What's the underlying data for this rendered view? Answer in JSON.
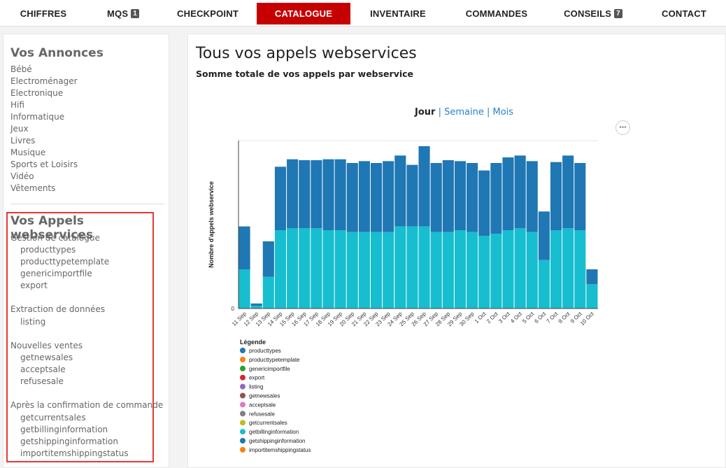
{
  "nav": {
    "items": [
      {
        "label": "CHIFFRES",
        "badge": ""
      },
      {
        "label": "MQS",
        "badge": "1"
      },
      {
        "label": "CHECKPOINT",
        "badge": ""
      },
      {
        "label": "CATALOGUE",
        "badge": ""
      },
      {
        "label": "INVENTAIRE",
        "badge": ""
      },
      {
        "label": "COMMANDES",
        "badge": ""
      },
      {
        "label": "CONSEILS",
        "badge": "7"
      },
      {
        "label": "CONTACT",
        "badge": ""
      }
    ],
    "active": "CATALOGUE",
    "active_color": "#c60000"
  },
  "sidebar": {
    "annonces_title": "Vos Annonces",
    "annonces": [
      "Bébé",
      "Electroménager",
      "Electronique",
      "Hifi",
      "Informatique",
      "Jeux",
      "Livres",
      "Musique",
      "Sports et Loisirs",
      "Vidéo",
      "Vêtements"
    ],
    "ws_title": "Vos Appels webservices",
    "groups": [
      {
        "title": "Gestion de catalogue",
        "items": [
          "producttypes",
          "producttypetemplate",
          "genericimportfile",
          "export"
        ]
      },
      {
        "title": "Extraction de données",
        "items": [
          "listing"
        ]
      },
      {
        "title": "Nouvelles ventes",
        "items": [
          "getnewsales",
          "acceptsale",
          "refusesale"
        ]
      },
      {
        "title": "Après la confirmation de commande",
        "items": [
          "getcurrentsales",
          "getbillinginformation",
          "getshippinginformation",
          "importitemshippingstatus"
        ]
      }
    ]
  },
  "main": {
    "title": "Tous vos appels webservices",
    "subtitle": "Somme totale de vos appels par webservice",
    "periods": {
      "selected": "Jour",
      "links": [
        "Semaine",
        "Mois"
      ],
      "separator": "|"
    },
    "menu_icon": "more-dots-icon"
  },
  "chart_data": {
    "type": "bar",
    "stacked": true,
    "categories": [
      "11 Sep",
      "12 Sep",
      "13 Sep",
      "14 Sep",
      "15 Sep",
      "16 Sep",
      "17 Sep",
      "18 Sep",
      "19 Sep",
      "20 Sep",
      "21 Sep",
      "22 Sep",
      "23 Sep",
      "24 Sep",
      "25 Sep",
      "26 Sep",
      "27 Sep",
      "28 Sep",
      "29 Sep",
      "30 Sep",
      "1 Oct",
      "2 Oct",
      "3 Oct",
      "4 Oct",
      "5 Oct",
      "6 Oct",
      "7 Oct",
      "8 Oct",
      "9 Oct",
      "10 Oct"
    ],
    "ylabel": "Nombre d'appels webservice",
    "ylim": [
      0,
      9000
    ],
    "yticks_visible": [
      "0"
    ],
    "grid": false,
    "legend_title": "Légende",
    "legend_position": "bottom-left",
    "series": [
      {
        "name": "producttypes",
        "color": "#1f77b4",
        "values": [
          2300,
          120,
          1900,
          3400,
          3700,
          3650,
          3650,
          3800,
          3800,
          3700,
          3800,
          3700,
          3800,
          3800,
          3300,
          4300,
          3700,
          3850,
          3700,
          3700,
          3500,
          3800,
          3900,
          3900,
          3800,
          2600,
          3650,
          3900,
          3600,
          800
        ]
      },
      {
        "name": "producttypetemplate",
        "color": "#ff7f0e",
        "values": [
          0,
          0,
          0,
          0,
          0,
          0,
          0,
          0,
          0,
          0,
          0,
          0,
          0,
          0,
          0,
          0,
          0,
          0,
          0,
          0,
          0,
          0,
          0,
          0,
          0,
          0,
          0,
          0,
          0,
          0
        ]
      },
      {
        "name": "genericimportfile",
        "color": "#2ca02c",
        "values": [
          0,
          0,
          0,
          0,
          0,
          0,
          0,
          0,
          0,
          0,
          0,
          0,
          0,
          0,
          0,
          0,
          0,
          0,
          0,
          0,
          0,
          0,
          0,
          0,
          0,
          0,
          0,
          0,
          0,
          0
        ]
      },
      {
        "name": "export",
        "color": "#d62728",
        "values": [
          0,
          0,
          0,
          0,
          0,
          0,
          0,
          0,
          0,
          0,
          0,
          0,
          0,
          0,
          0,
          0,
          0,
          0,
          0,
          0,
          0,
          0,
          0,
          0,
          0,
          0,
          0,
          0,
          0,
          0
        ]
      },
      {
        "name": "listing",
        "color": "#9467bd",
        "values": [
          0,
          0,
          0,
          0,
          0,
          0,
          0,
          0,
          0,
          0,
          0,
          0,
          0,
          0,
          0,
          0,
          0,
          0,
          0,
          0,
          0,
          0,
          0,
          0,
          0,
          0,
          0,
          0,
          0,
          0
        ]
      },
      {
        "name": "getnewsales",
        "color": "#8c564b",
        "values": [
          0,
          0,
          0,
          0,
          0,
          0,
          0,
          0,
          0,
          0,
          0,
          0,
          0,
          0,
          0,
          0,
          0,
          0,
          0,
          0,
          0,
          0,
          0,
          0,
          0,
          0,
          0,
          0,
          0,
          0
        ]
      },
      {
        "name": "acceptsale",
        "color": "#e377c2",
        "values": [
          0,
          0,
          0,
          0,
          0,
          0,
          0,
          0,
          0,
          0,
          0,
          0,
          0,
          0,
          0,
          0,
          0,
          0,
          0,
          0,
          0,
          0,
          0,
          0,
          0,
          0,
          0,
          0,
          0,
          0
        ]
      },
      {
        "name": "refusesale",
        "color": "#7f7f7f",
        "values": [
          0,
          0,
          0,
          0,
          0,
          0,
          0,
          0,
          0,
          0,
          0,
          0,
          0,
          0,
          0,
          0,
          0,
          0,
          0,
          0,
          0,
          0,
          0,
          0,
          0,
          0,
          0,
          0,
          0,
          0
        ]
      },
      {
        "name": "getcurrentsales",
        "color": "#bcbd22",
        "values": [
          0,
          0,
          0,
          0,
          0,
          0,
          0,
          0,
          0,
          0,
          0,
          0,
          0,
          0,
          0,
          0,
          0,
          0,
          0,
          0,
          0,
          0,
          0,
          0,
          0,
          0,
          0,
          0,
          0,
          0
        ]
      },
      {
        "name": "getbillinginformation",
        "color": "#17becf",
        "values": [
          2100,
          150,
          1700,
          4200,
          4300,
          4300,
          4300,
          4200,
          4200,
          4100,
          4100,
          4100,
          4100,
          4400,
          4400,
          4400,
          4100,
          4100,
          4200,
          4100,
          3900,
          4000,
          4200,
          4300,
          4100,
          2600,
          4200,
          4300,
          4200,
          1300
        ]
      },
      {
        "name": "getshippinginformation",
        "color": "#1f77b4",
        "values": [
          0,
          0,
          0,
          0,
          0,
          0,
          0,
          0,
          0,
          0,
          0,
          0,
          0,
          0,
          0,
          0,
          0,
          0,
          0,
          0,
          0,
          0,
          0,
          0,
          0,
          0,
          0,
          0,
          0,
          0
        ]
      },
      {
        "name": "importitemshippingstatus",
        "color": "#ff7f0e",
        "values": [
          0,
          0,
          0,
          0,
          0,
          0,
          0,
          0,
          0,
          0,
          0,
          0,
          0,
          0,
          0,
          0,
          0,
          0,
          0,
          0,
          0,
          0,
          0,
          0,
          0,
          0,
          0,
          0,
          0,
          0
        ]
      }
    ]
  }
}
